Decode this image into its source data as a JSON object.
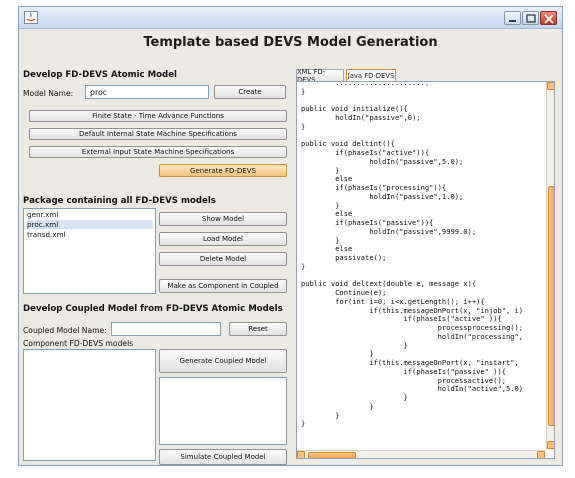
{
  "app": {
    "heading": "Template based DEVS Model Generation"
  },
  "atomic": {
    "title": "Develop FD-DEVS Atomic Model",
    "model_name_label": "Model Name:",
    "model_name_value": "proc",
    "create_label": "Create",
    "finite_state_label": "Finite State - Time Advance Functions",
    "internal_label": "Default Internal State Machine Specifications",
    "external_label": "External Input State Machine Specifications",
    "generate_label": "Generate FD-DEVS"
  },
  "package": {
    "title": "Package containing all FD-DEVS models",
    "files": [
      "genr.xml",
      "proc.xml",
      "transd.xml"
    ],
    "selected": "proc.xml",
    "show_label": "Show Model",
    "load_label": "Load Model",
    "delete_label": "Delete Model",
    "make_label": "Make as Component in Coupled"
  },
  "coupled": {
    "title": "Develop Coupled Model from FD-DEVS Atomic Models",
    "name_label": "Coupled Model Name:",
    "name_value": "",
    "reset_label": "Reset",
    "components_label": "Component FD-DEVS models",
    "generate_label": "Generate Coupled Model",
    "simulate_label": "Simulate Coupled Model"
  },
  "code_view": {
    "tabs": [
      "XML FD-DEVS",
      "Java FD-DEVS"
    ],
    "active_tab": "Java FD-DEVS",
    "code": "        ......................\n}\n\npublic void initialize(){\n        holdIn(\"passive\",0);\n}\n\npublic void deltint(){\n        if(phaseIs(\"active\")){\n                holdIn(\"passive\",5.0);\n        }\n        else\n        if(phaseIs(\"processing\")){\n                holdIn(\"passive\",1.0);\n        }\n        else\n        if(phaseIs(\"passive\")){\n                holdIn(\"passive\",9999.0);\n        }\n        else\n        passivate();\n}\n\npublic void deltext(double e, message x){\n        Continue(e);\n        for(int i=0; i<x.getLength(); i++){\n                if(this.messageOnPort(x, \"injob\", i)\n                        if(phaseIs(\"active\" )){\n                                processprocessing();\n                                holdIn(\"processing\",\n                        }\n                }\n                if(this.messageOnPort(x, \"instart\",\n                        if(phaseIs(\"passive\" )){\n                                processactive();\n                                holdIn(\"active\",5.0)\n                        }\n                }\n        }\n}"
  },
  "colors": {
    "accent": "#f6c27b",
    "titlebar": "#c4d6ee",
    "selection": "#d4e2f2"
  }
}
